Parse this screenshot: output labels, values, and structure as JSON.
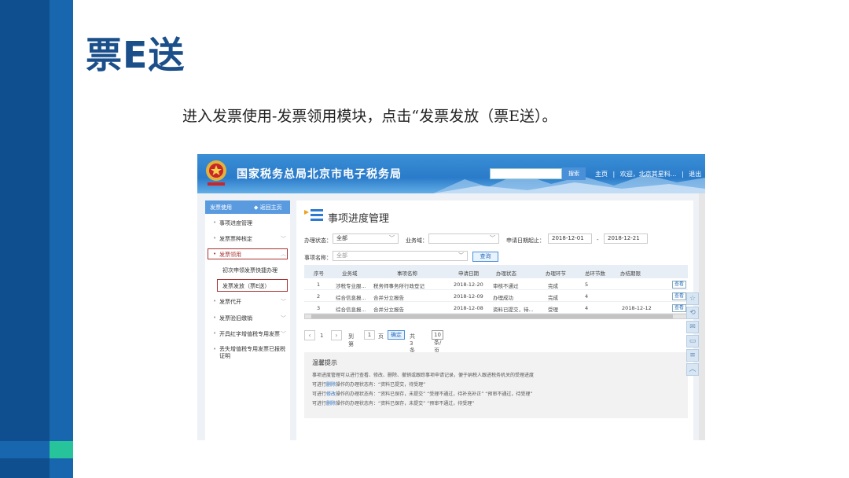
{
  "slide": {
    "title": "票E送",
    "description": "进入发票使用-发票领用模块，点击“发票发放（票E送）。"
  },
  "header": {
    "site_title": "国家税务总局北京市电子税务局",
    "search_button": "搜索",
    "links": [
      "主页",
      "|",
      "欢迎，北京其星科...",
      "|",
      "退出"
    ]
  },
  "nav": {
    "section_title": "发票使用",
    "back_link": "◆ 返回主页",
    "items": [
      {
        "label": "事项进度管理",
        "chev": ""
      },
      {
        "label": "发票票种核定",
        "chev": "﹀"
      },
      {
        "label": "发票领用",
        "chev": "︿"
      },
      {
        "label": "初次申领发票快捷办理",
        "sub": true
      },
      {
        "label": "发票发放（票E送）",
        "sub": true
      },
      {
        "label": "发票代开",
        "chev": "﹀"
      },
      {
        "label": "发票验旧缴销",
        "chev": "﹀"
      },
      {
        "label": "开具红字增值税专用发票",
        "chev": "﹀"
      },
      {
        "label": "丢失增值税专用发票已报税证明",
        "chev": ""
      }
    ]
  },
  "main": {
    "page_title": "事项进度管理",
    "filters": {
      "status_label": "办理状态：",
      "status_value": "全部",
      "domain_label": "业务域：",
      "domain_value": "",
      "date_label": "申请日期起止：",
      "date_from": "2018-12-01",
      "date_sep": "-",
      "date_to": "2018-12-21",
      "name_label": "事项名称：",
      "name_value": "全部",
      "query_button": "查询"
    },
    "table": {
      "headers": [
        "序号",
        "业务域",
        "事项名称",
        "申请日期",
        "办理状态",
        "办理环节",
        "总环节数",
        "办结期限"
      ],
      "rows": [
        [
          "1",
          "涉税专业服...",
          "税务师事务所行政登记",
          "2018-12-20",
          "审核不通过",
          "完成",
          "5",
          ""
        ],
        [
          "2",
          "综合信息报...",
          "合并分立报告",
          "2018-12-09",
          "办理成功",
          "完成",
          "4",
          ""
        ],
        [
          "3",
          "综合信息报...",
          "合并分立报告",
          "2018-12-08",
          "资料已提交，待...",
          "受理",
          "4",
          "2018-12-12"
        ]
      ],
      "view_label": "查看"
    },
    "pager": {
      "prev": "‹",
      "first": "1",
      "next": "›",
      "goto_label": "到第",
      "page_value": "1",
      "page_unit": "页",
      "confirm": "确定",
      "total": "共 3 条",
      "page_size": "10 条/页"
    },
    "tips": {
      "title": "温馨提示",
      "lines": [
        {
          "pre": "事项进度管理可以进行查看、修改、删除、撤销或跟踪事项申请记录，便于纳税人跟进税务机关的受理进度",
          "hl": "",
          "post": ""
        },
        {
          "pre": "可进行",
          "hl": "删除",
          "post": "操作的办理状态有：“资料已提交，待受理”"
        },
        {
          "pre": "可进行",
          "hl": "修改",
          "post": "操作的办理状态有：“资料已保存，未提交”  “受理不通过，待补充补正”  “预审不通过，待受理”"
        },
        {
          "pre": "可进行",
          "hl": "删除",
          "post": "操作的办理状态有：“资料已保存，未提交”  “预审不通过，待受理”"
        }
      ]
    }
  },
  "colors": {
    "slide_blue": "#0f4f8f",
    "accent_green": "#27c39a",
    "header_blue": "#2a7bc9",
    "highlight_box": "#a83232"
  }
}
